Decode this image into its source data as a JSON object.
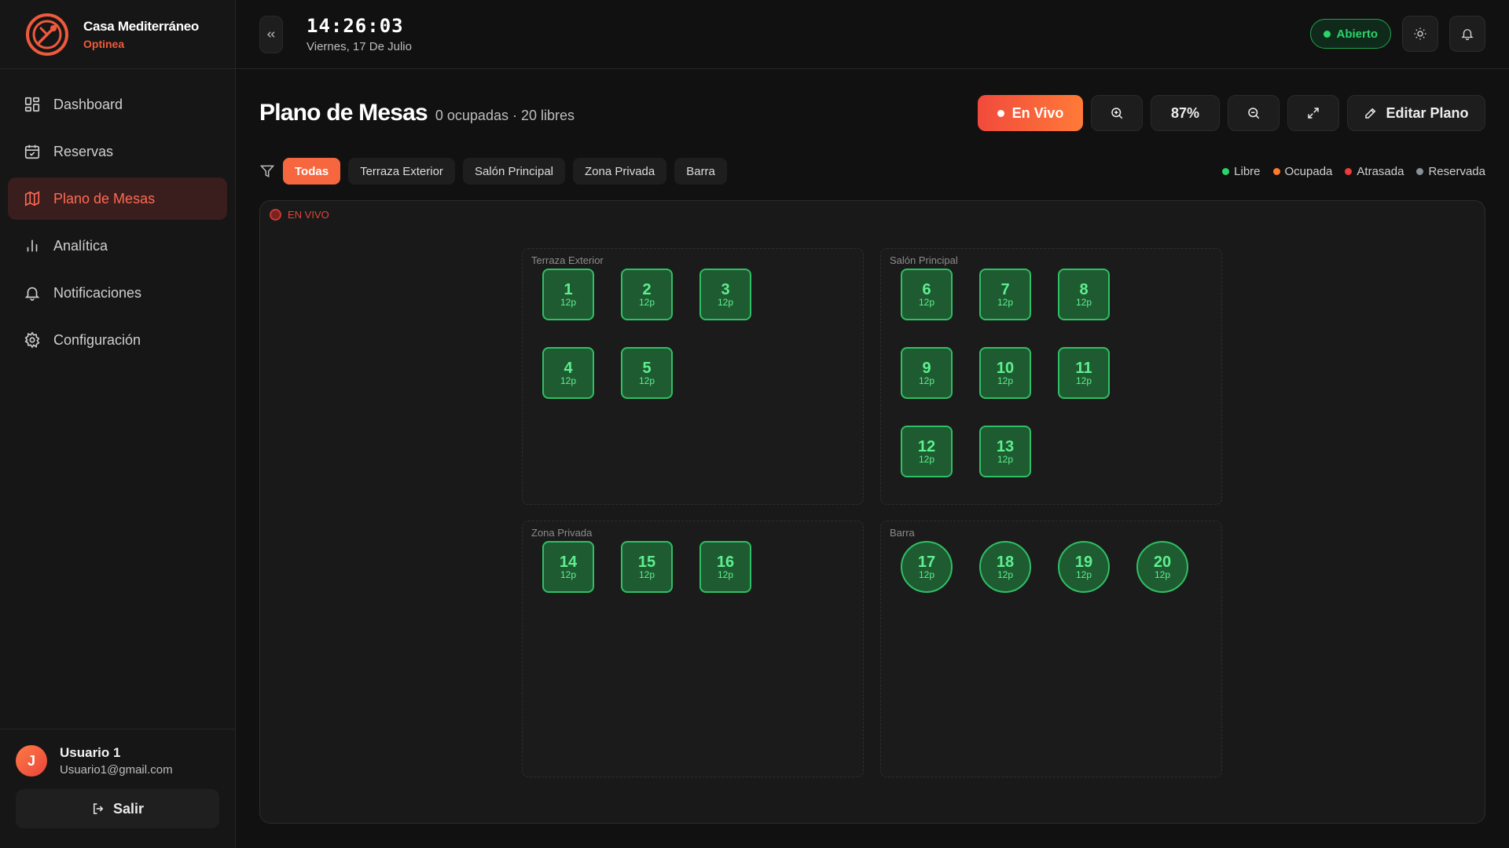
{
  "brand": {
    "name": "Casa Mediterráneo",
    "sub": "Optinea"
  },
  "nav": {
    "items": [
      {
        "label": "Dashboard"
      },
      {
        "label": "Reservas"
      },
      {
        "label": "Plano de Mesas"
      },
      {
        "label": "Analítica"
      },
      {
        "label": "Notificaciones"
      },
      {
        "label": "Configuración"
      }
    ]
  },
  "user": {
    "initial": "J",
    "name": "Usuario 1",
    "email": "Usuario1@gmail.com",
    "logout_label": "Salir"
  },
  "topbar": {
    "time": "14:26:03",
    "date": "Viernes, 17 De Julio",
    "status_label": "Abierto",
    "status_color": "#2bd46b"
  },
  "page": {
    "title": "Plano de Mesas",
    "stats": "0 ocupadas · 20 libres"
  },
  "toolbar": {
    "live_label": "En Vivo",
    "zoom_label": "87%",
    "edit_label": "Editar Plano"
  },
  "filters": [
    "Todas",
    "Terraza Exterior",
    "Salón Principal",
    "Zona Privada",
    "Barra"
  ],
  "legend": [
    {
      "label": "Libre",
      "color": "#2bd46b"
    },
    {
      "label": "Ocupada",
      "color": "#ff7a2a"
    },
    {
      "label": "Atrasada",
      "color": "#ef3b3b"
    },
    {
      "label": "Reservada",
      "color": "#8a8f98"
    }
  ],
  "canvas": {
    "live_tag": "EN VIVO"
  },
  "zones": [
    {
      "name": "Terraza Exterior",
      "tables": [
        {
          "num": "1",
          "cap": "12p"
        },
        {
          "num": "2",
          "cap": "12p"
        },
        {
          "num": "3",
          "cap": "12p"
        },
        {
          "num": "4",
          "cap": "12p"
        },
        {
          "num": "5",
          "cap": "12p"
        }
      ]
    },
    {
      "name": "Salón Principal",
      "tables": [
        {
          "num": "6",
          "cap": "12p"
        },
        {
          "num": "7",
          "cap": "12p"
        },
        {
          "num": "8",
          "cap": "12p"
        },
        {
          "num": "9",
          "cap": "12p"
        },
        {
          "num": "10",
          "cap": "12p"
        },
        {
          "num": "11",
          "cap": "12p"
        },
        {
          "num": "12",
          "cap": "12p"
        },
        {
          "num": "13",
          "cap": "12p"
        }
      ]
    },
    {
      "name": "Zona Privada",
      "tables": [
        {
          "num": "14",
          "cap": "12p"
        },
        {
          "num": "15",
          "cap": "12p"
        },
        {
          "num": "16",
          "cap": "12p"
        }
      ]
    },
    {
      "name": "Barra",
      "tables": [
        {
          "num": "17",
          "cap": "12p"
        },
        {
          "num": "18",
          "cap": "12p"
        },
        {
          "num": "19",
          "cap": "12p"
        },
        {
          "num": "20",
          "cap": "12p"
        }
      ]
    }
  ]
}
